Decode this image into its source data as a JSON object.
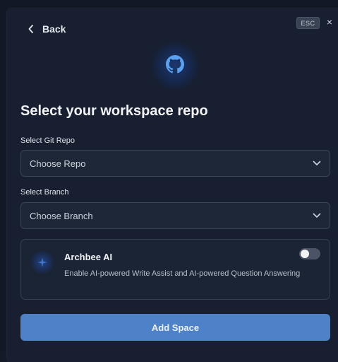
{
  "header": {
    "back_label": "Back",
    "esc_label": "ESC",
    "close_symbol": "×"
  },
  "icons": {
    "repo_provider": "github-icon",
    "ai": "sparkle-icon"
  },
  "title": "Select your workspace repo",
  "git_repo": {
    "label": "Select Git Repo",
    "placeholder": "Choose Repo"
  },
  "branch": {
    "label": "Select Branch",
    "placeholder": "Choose Branch"
  },
  "ai_card": {
    "title": "Archbee AI",
    "description": "Enable AI-powered Write Assist and AI-powered Question Answering",
    "enabled": false
  },
  "submit_label": "Add Space",
  "colors": {
    "background": "#171f30",
    "accent": "#4d82c8",
    "field_border": "#3a4456"
  }
}
